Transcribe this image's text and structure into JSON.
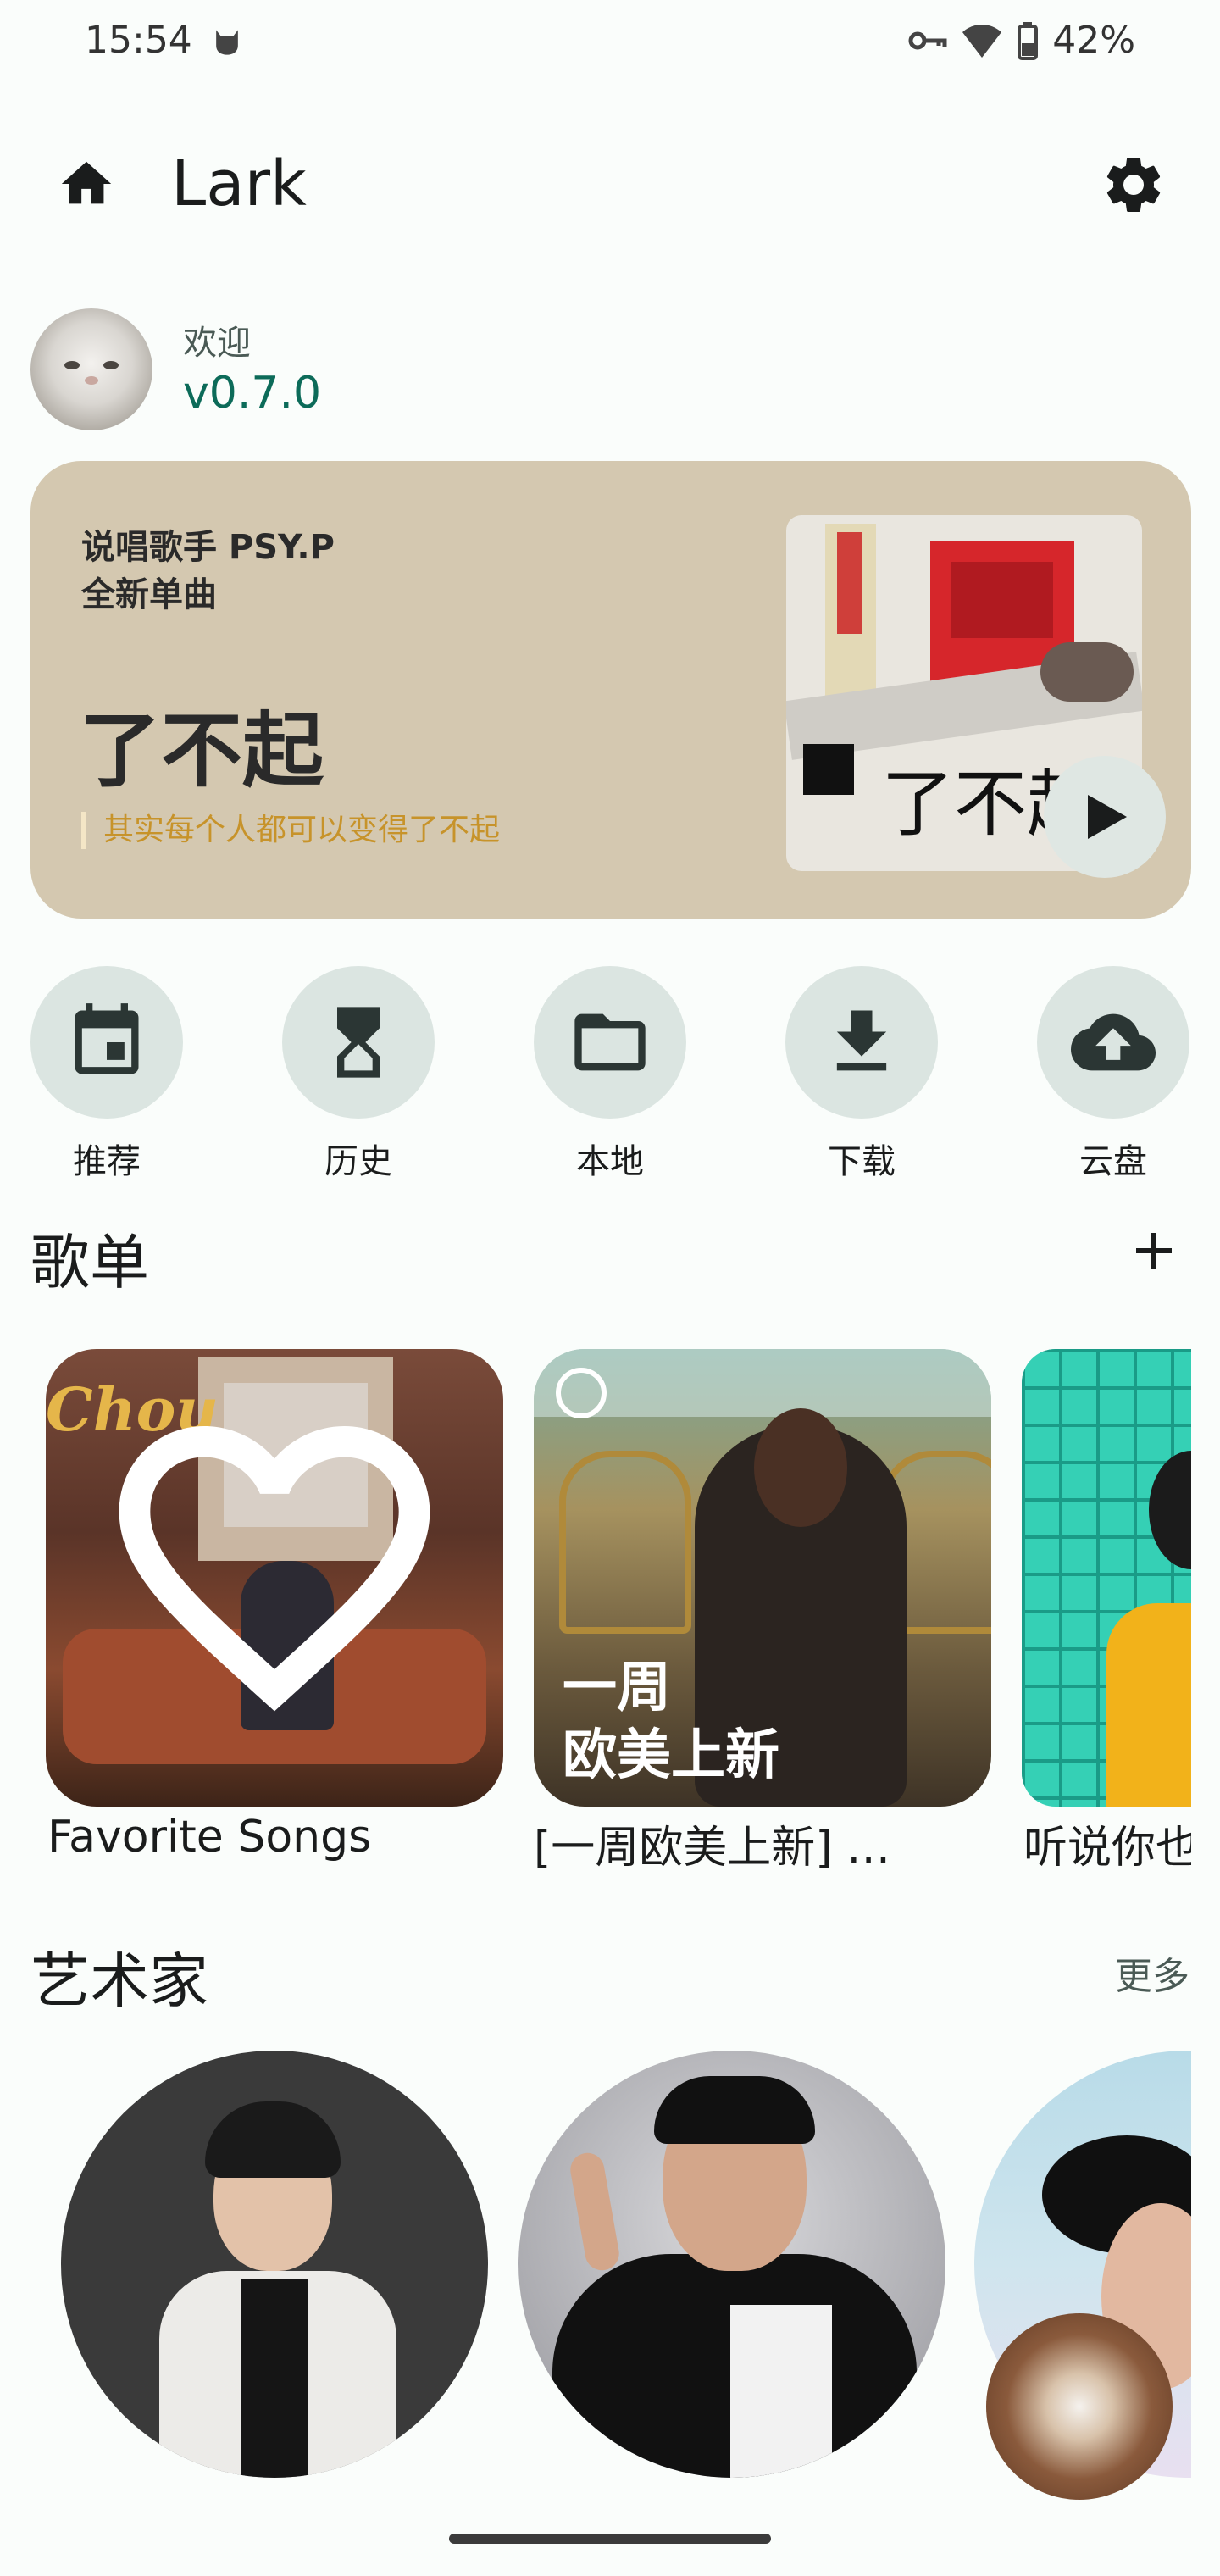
{
  "status_bar": {
    "time": "15:54",
    "battery": "42%"
  },
  "app_bar": {
    "title": "Lark"
  },
  "welcome": {
    "greeting": "欢迎",
    "version": "v0.7.0"
  },
  "banner": {
    "subtitle_line1": "说唱歌手 PSY.P",
    "subtitle_line2": "全新单曲",
    "headline": "了不起",
    "description": "其实每个人都可以变得了不起",
    "cover_text": "了不起"
  },
  "shortcuts": [
    {
      "label": "推荐",
      "icon": "calendar-icon"
    },
    {
      "label": "历史",
      "icon": "hourglass-icon"
    },
    {
      "label": "本地",
      "icon": "folder-icon"
    },
    {
      "label": "下载",
      "icon": "download-icon"
    },
    {
      "label": "云盘",
      "icon": "cloud-upload-icon"
    }
  ],
  "playlists_section": {
    "title": "歌单"
  },
  "playlists": [
    {
      "title": "Favorite Songs",
      "cover_text": "Chou"
    },
    {
      "title": "[一周欧美上新]  …",
      "cover_text": "一周\n欧美上新"
    },
    {
      "title": "听说你也"
    }
  ],
  "artists_section": {
    "title": "艺术家",
    "more_label": "更多"
  },
  "colors": {
    "accent": "#0c6b59",
    "banner_bg": "#d4c8b0",
    "banner_accent": "#c7932a",
    "chip_bg": "#dbe5e1"
  }
}
